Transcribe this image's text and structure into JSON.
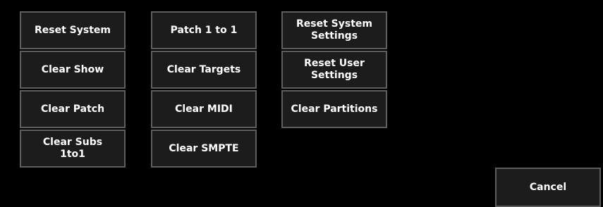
{
  "buttons": {
    "reset_system": "Reset System",
    "patch_1_to_1": "Patch 1 to 1",
    "reset_system_settings": "Reset System\nSettings",
    "clear_show": "Clear Show",
    "clear_targets": "Clear Targets",
    "reset_user_settings": "Reset User\nSettings",
    "clear_patch": "Clear Patch",
    "clear_midi": "Clear MIDI",
    "clear_partitions": "Clear Partitions",
    "clear_subs_1to1": "Clear Subs\n1to1",
    "clear_smpte": "Clear SMPTE",
    "cancel": "Cancel"
  }
}
